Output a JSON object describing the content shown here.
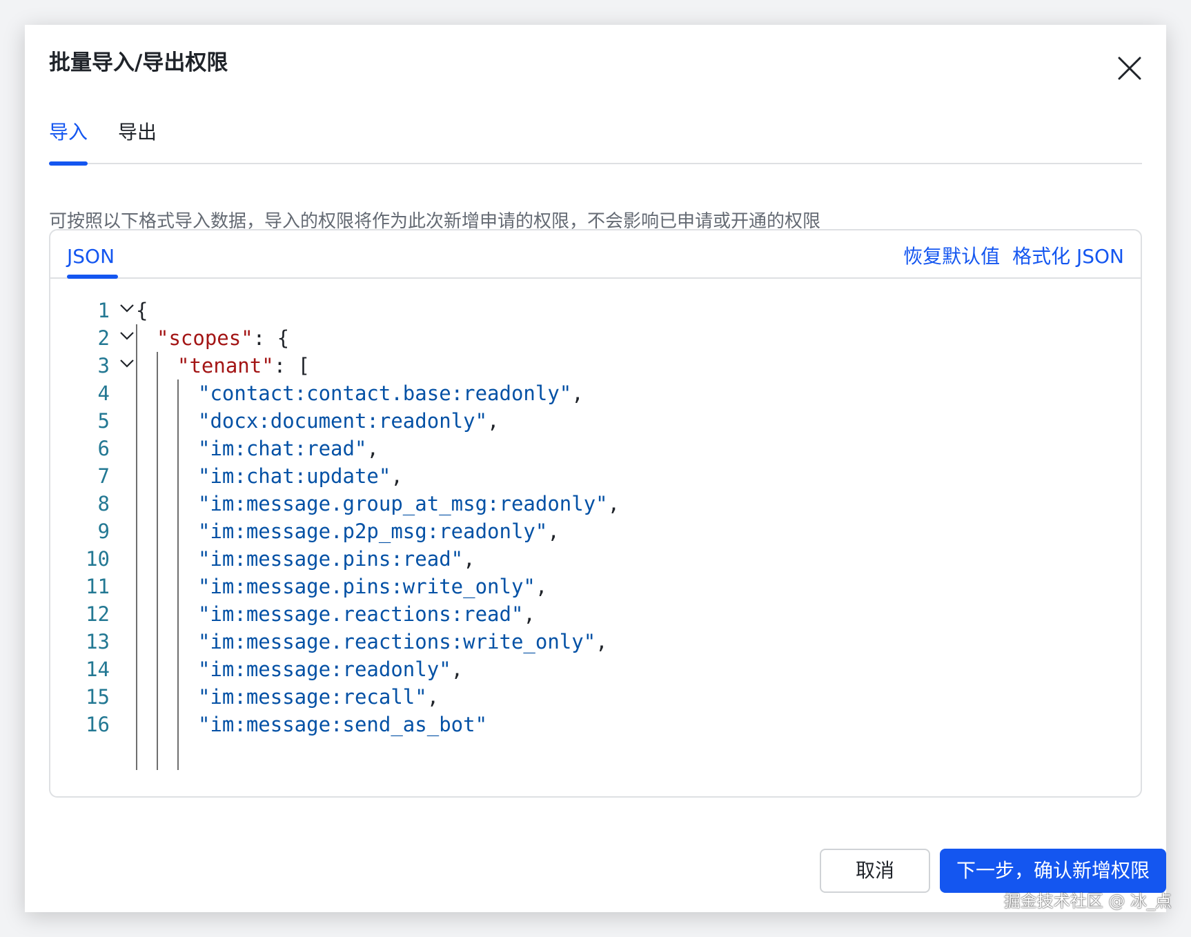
{
  "dialog": {
    "title": "批量导入/导出权限",
    "close_icon": "close-icon"
  },
  "tabs": [
    {
      "label": "导入",
      "active": true
    },
    {
      "label": "导出",
      "active": false
    }
  ],
  "description": "可按照以下格式导入数据，导入的权限将作为此次新增申请的权限，不会影响已申请或开通的权限",
  "editor": {
    "tab_label": "JSON",
    "restore_default_label": "恢复默认值",
    "format_json_label": "格式化 JSON",
    "lines": [
      {
        "num": "1",
        "foldable": true,
        "segments": [
          {
            "t": "{",
            "c": "punc"
          }
        ]
      },
      {
        "num": "2",
        "foldable": true,
        "segments": [
          {
            "t": "\"scopes\"",
            "c": "key"
          },
          {
            "t": ": {",
            "c": "punc"
          }
        ]
      },
      {
        "num": "3",
        "foldable": true,
        "segments": [
          {
            "t": "\"tenant\"",
            "c": "key"
          },
          {
            "t": ": [",
            "c": "punc"
          }
        ]
      },
      {
        "num": "4",
        "foldable": false,
        "segments": [
          {
            "t": "\"contact:contact.base:readonly\"",
            "c": "str"
          },
          {
            "t": ",",
            "c": "punc"
          }
        ]
      },
      {
        "num": "5",
        "foldable": false,
        "segments": [
          {
            "t": "\"docx:document:readonly\"",
            "c": "str"
          },
          {
            "t": ",",
            "c": "punc"
          }
        ]
      },
      {
        "num": "6",
        "foldable": false,
        "segments": [
          {
            "t": "\"im:chat:read\"",
            "c": "str"
          },
          {
            "t": ",",
            "c": "punc"
          }
        ]
      },
      {
        "num": "7",
        "foldable": false,
        "segments": [
          {
            "t": "\"im:chat:update\"",
            "c": "str"
          },
          {
            "t": ",",
            "c": "punc"
          }
        ]
      },
      {
        "num": "8",
        "foldable": false,
        "segments": [
          {
            "t": "\"im:message.group_at_msg:readonly\"",
            "c": "str"
          },
          {
            "t": ",",
            "c": "punc"
          }
        ]
      },
      {
        "num": "9",
        "foldable": false,
        "segments": [
          {
            "t": "\"im:message.p2p_msg:readonly\"",
            "c": "str"
          },
          {
            "t": ",",
            "c": "punc"
          }
        ]
      },
      {
        "num": "10",
        "foldable": false,
        "segments": [
          {
            "t": "\"im:message.pins:read\"",
            "c": "str"
          },
          {
            "t": ",",
            "c": "punc"
          }
        ]
      },
      {
        "num": "11",
        "foldable": false,
        "segments": [
          {
            "t": "\"im:message.pins:write_only\"",
            "c": "str"
          },
          {
            "t": ",",
            "c": "punc"
          }
        ]
      },
      {
        "num": "12",
        "foldable": false,
        "segments": [
          {
            "t": "\"im:message.reactions:read\"",
            "c": "str"
          },
          {
            "t": ",",
            "c": "punc"
          }
        ]
      },
      {
        "num": "13",
        "foldable": false,
        "segments": [
          {
            "t": "\"im:message.reactions:write_only\"",
            "c": "str"
          },
          {
            "t": ",",
            "c": "punc"
          }
        ]
      },
      {
        "num": "14",
        "foldable": false,
        "segments": [
          {
            "t": "\"im:message:readonly\"",
            "c": "str"
          },
          {
            "t": ",",
            "c": "punc"
          }
        ]
      },
      {
        "num": "15",
        "foldable": false,
        "segments": [
          {
            "t": "\"im:message:recall\"",
            "c": "str"
          },
          {
            "t": ",",
            "c": "punc"
          }
        ]
      },
      {
        "num": "16",
        "foldable": false,
        "segments": [
          {
            "t": "\"im:message:send_as_bot\"",
            "c": "str"
          }
        ]
      }
    ]
  },
  "footer": {
    "cancel_label": "取消",
    "next_label": "下一步，确认新增权限"
  },
  "watermark": "掘金技术社区 @ 冰_点",
  "colors": {
    "accent": "#1456f0",
    "json_key": "#a31515",
    "json_string": "#0451a5",
    "line_number": "#237893"
  }
}
